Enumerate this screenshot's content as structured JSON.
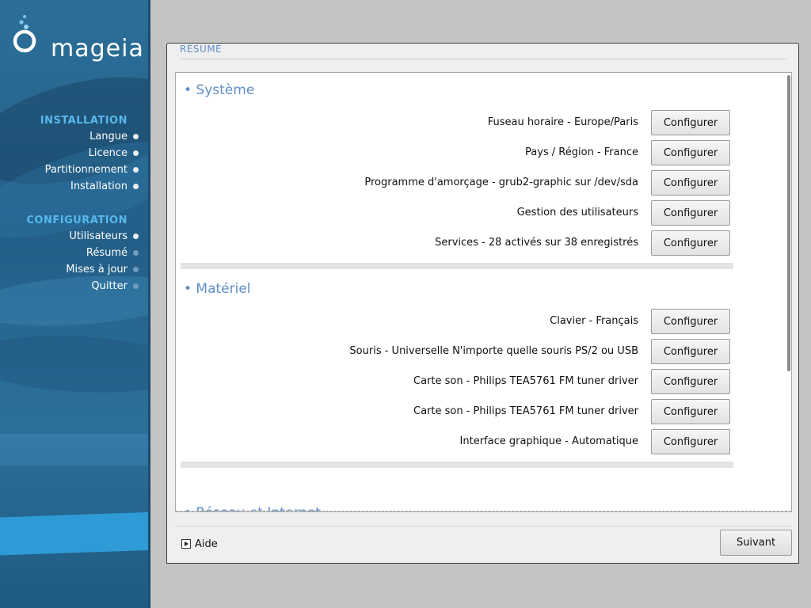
{
  "sidebar": {
    "logo_text": "mageia",
    "installation_title": "INSTALLATION",
    "installation_items": [
      {
        "label": "Langue",
        "state": "done"
      },
      {
        "label": "Licence",
        "state": "done"
      },
      {
        "label": "Partitionnement",
        "state": "done"
      },
      {
        "label": "Installation",
        "state": "done"
      }
    ],
    "configuration_title": "CONFIGURATION",
    "configuration_items": [
      {
        "label": "Utilisateurs",
        "state": "done"
      },
      {
        "label": "Résumé",
        "state": "current"
      },
      {
        "label": "Mises à jour",
        "state": "pending"
      },
      {
        "label": "Quitter",
        "state": "pending"
      }
    ]
  },
  "window": {
    "title": "RÉSUMÉ",
    "sections": [
      {
        "title": "• Système",
        "rows": [
          {
            "label": "Fuseau horaire - Europe/Paris",
            "button": "Configurer"
          },
          {
            "label": "Pays / Région - France",
            "button": "Configurer"
          },
          {
            "label": "Programme d'amorçage - grub2-graphic sur /dev/sda",
            "button": "Configurer"
          },
          {
            "label": "Gestion des utilisateurs",
            "button": "Configurer"
          },
          {
            "label": "Services - 28 activés sur 38 enregistrés",
            "button": "Configurer"
          }
        ]
      },
      {
        "title": "• Matériel",
        "rows": [
          {
            "label": "Clavier - Français",
            "button": "Configurer"
          },
          {
            "label": "Souris - Universelle N'importe quelle souris PS/2 ou USB",
            "button": "Configurer"
          },
          {
            "label": "Carte son - Philips TEA5761 FM tuner driver",
            "button": "Configurer"
          },
          {
            "label": "Carte son - Philips TEA5761 FM tuner driver",
            "button": "Configurer"
          },
          {
            "label": "Interface graphique - Automatique",
            "button": "Configurer"
          }
        ]
      },
      {
        "title": "• Réseau et Internet",
        "rows": []
      }
    ],
    "help_label": "Aide",
    "next_label": "Suivant"
  },
  "colors": {
    "accent": "#5f8fc6",
    "sidebar_title": "#58b8ee",
    "sidebar_bg": "#2b6f98"
  }
}
